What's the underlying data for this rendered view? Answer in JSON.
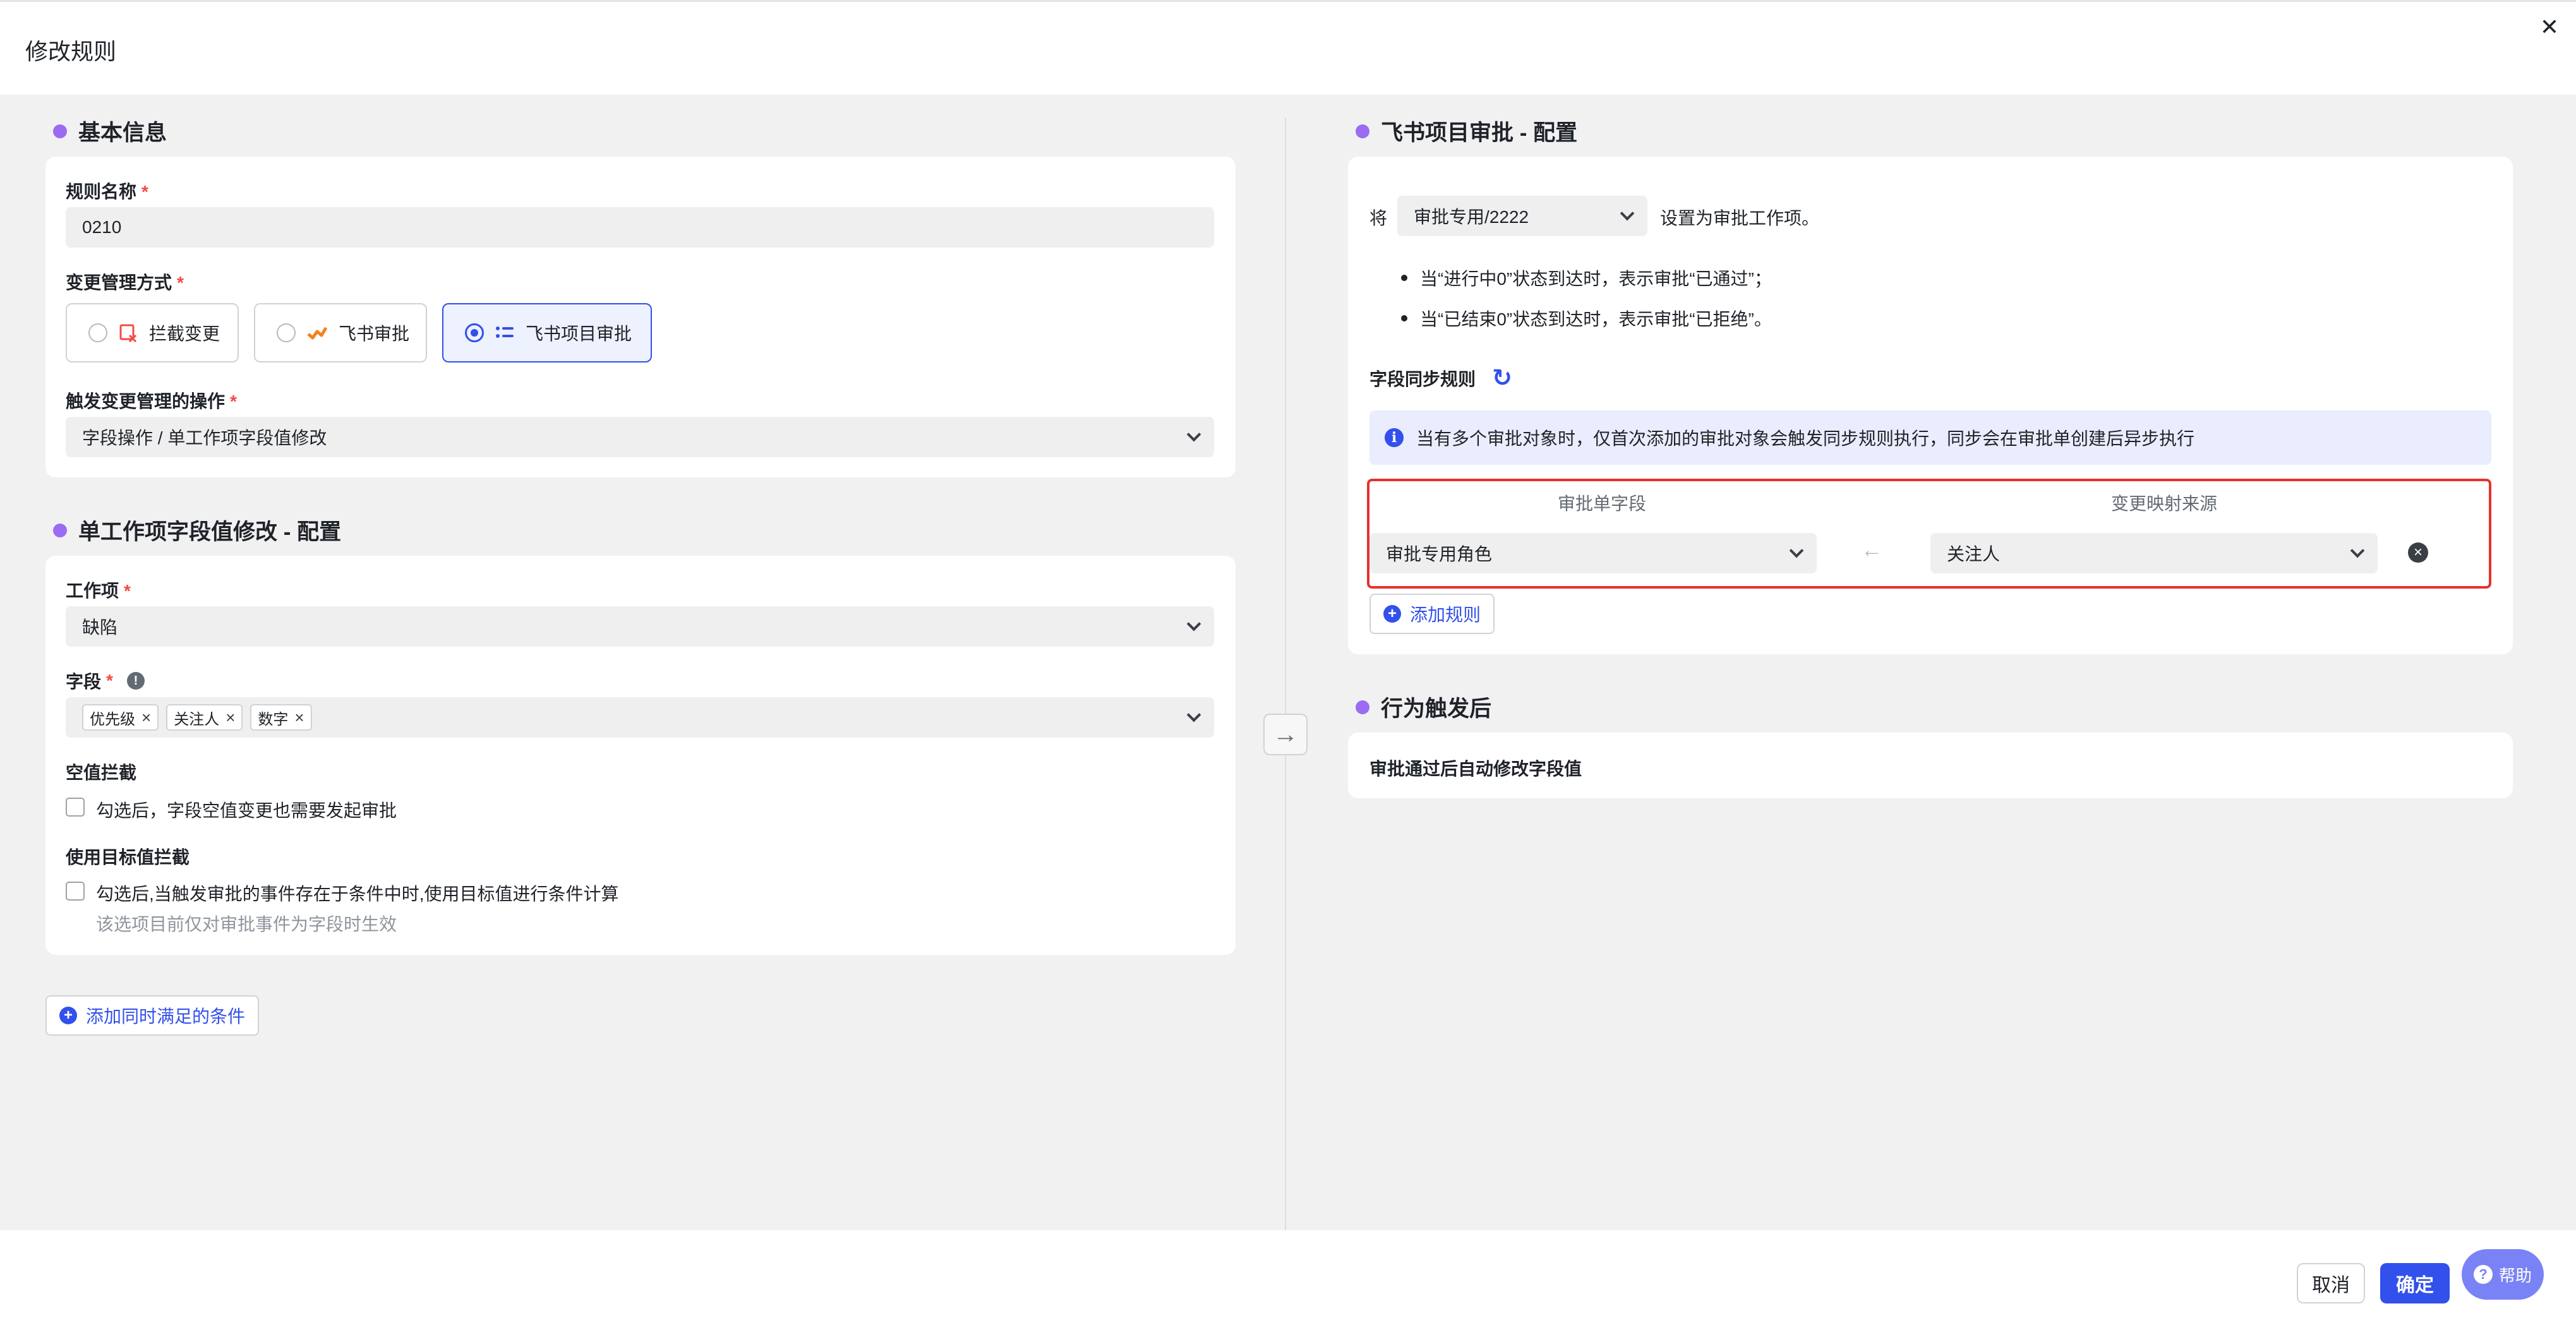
{
  "modal": {
    "title": "修改规则",
    "close": "✕"
  },
  "basic_info": {
    "section_title": "基本信息",
    "rule_name_label": "规则名称",
    "required_mark": "*",
    "rule_name_value": "0210",
    "change_mode_label": "变更管理方式",
    "mode_options": [
      {
        "label": "拦截变更",
        "selected": false
      },
      {
        "label": "飞书审批",
        "selected": false
      },
      {
        "label": "飞书项目审批",
        "selected": true
      }
    ],
    "trigger_label": "触发变更管理的操作",
    "trigger_value": "字段操作 / 单工作项字段值修改"
  },
  "field_config": {
    "section_title": "单工作项字段值修改 - 配置",
    "work_item_label": "工作项",
    "work_item_value": "缺陷",
    "field_label": "字段",
    "field_tags": [
      "优先级",
      "关注人",
      "数字"
    ],
    "empty_block_label": "空值拦截",
    "empty_block_text": "勾选后，字段空值变更也需要发起审批",
    "target_label": "使用目标值拦截",
    "target_text": "勾选后,当触发审批的事件存在于条件中时,使用目标值进行条件计算",
    "target_hint": "该选项目前仅对审批事件为字段时生效",
    "add_condition": "添加同时满足的条件"
  },
  "approval_config": {
    "section_title": "飞书项目审批 - 配置",
    "prefix": "将",
    "approval_select": "审批专用/2222",
    "suffix": "设置为审批工作项。",
    "bullets": [
      "当“进行中0”状态到达时，表示审批“已通过”；",
      "当“已结束0”状态到达时，表示审批“已拒绝”。"
    ],
    "sync_rules_label": "字段同步规则",
    "info_text": "当有多个审批对象时，仅首次添加的审批对象会触发同步规则执行，同步会在审批单创建后异步执行",
    "col_left": "审批单字段",
    "col_right": "变更映射来源",
    "left_value": "审批专用角色",
    "right_value": "关注人",
    "add_rule": "添加规则"
  },
  "after_trigger": {
    "section_title": "行为触发后",
    "text": "审批通过后自动修改字段值"
  },
  "footer": {
    "cancel": "取消",
    "confirm": "确定",
    "help": "帮助",
    "help_icon": "?"
  },
  "icons": {
    "plus": "+",
    "info": "i",
    "remove": "×",
    "tag_remove": "×",
    "mid_arrow": "→",
    "map_arrow": "←",
    "refresh": "↻"
  },
  "colors": {
    "primary": "#3250eb",
    "section_dot": "#9b6cf2",
    "required": "#f54a45",
    "highlight_border": "#e5322d",
    "help_button": "#7a83f5"
  }
}
